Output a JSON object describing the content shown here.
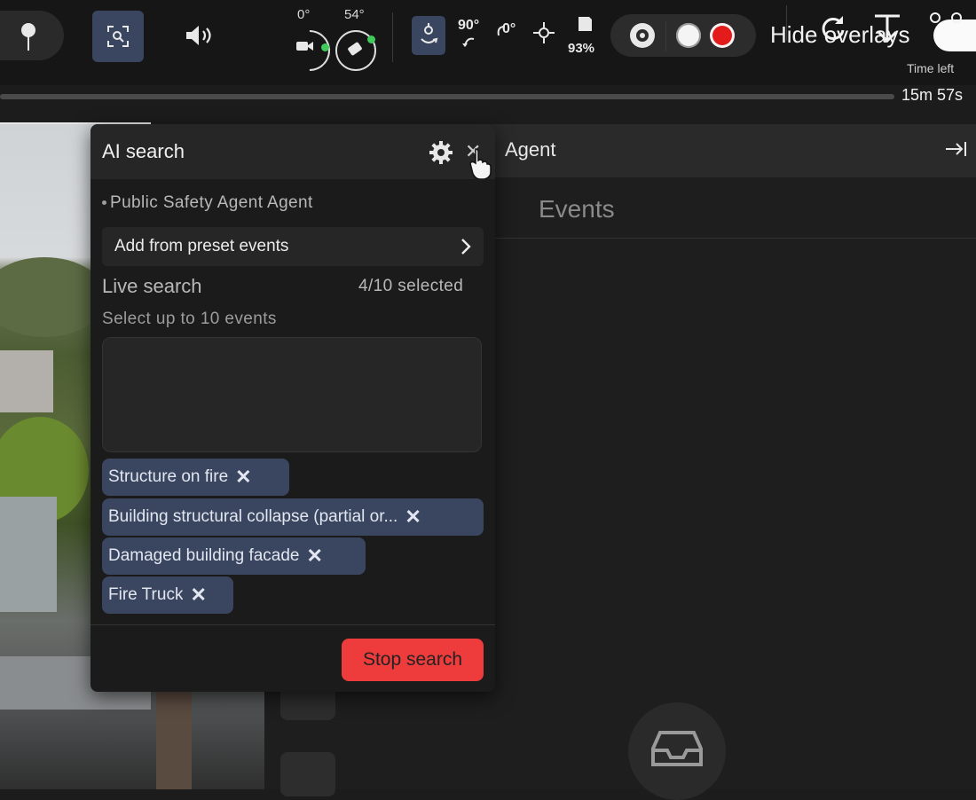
{
  "toolbar": {
    "gimbal_pitch": "0°",
    "drone_yaw": "54°",
    "rth_angle": "90°",
    "rotate_angle": "0°",
    "battery": "93%",
    "hide_overlays_label": "Hide overlays",
    "time_left_label": "Time left",
    "time_left_value": "15m 57s",
    "progress_fraction": 1.0
  },
  "right_panel": {
    "agent_title": "Agent",
    "events_title": "Events",
    "collapse_icon": "collapse-right-icon"
  },
  "popup": {
    "title": "AI search",
    "close_glyph": "✕",
    "agent_name": "Public Safety Agent Agent",
    "preset_label": "Add from preset events",
    "live_search_label": "Live search",
    "selected_count": "4/10 selected",
    "hint": "Select up to 10 events",
    "chips": [
      "Structure on fire",
      "Building structural collapse (partial or...",
      "Damaged building facade",
      "Fire Truck"
    ],
    "stop_label": "Stop search"
  },
  "colors": {
    "accent_blue": "#3a4660",
    "record_red": "#e31b1b",
    "stop_red": "#ee3b3b",
    "gimbal_green": "#3fca5a"
  }
}
